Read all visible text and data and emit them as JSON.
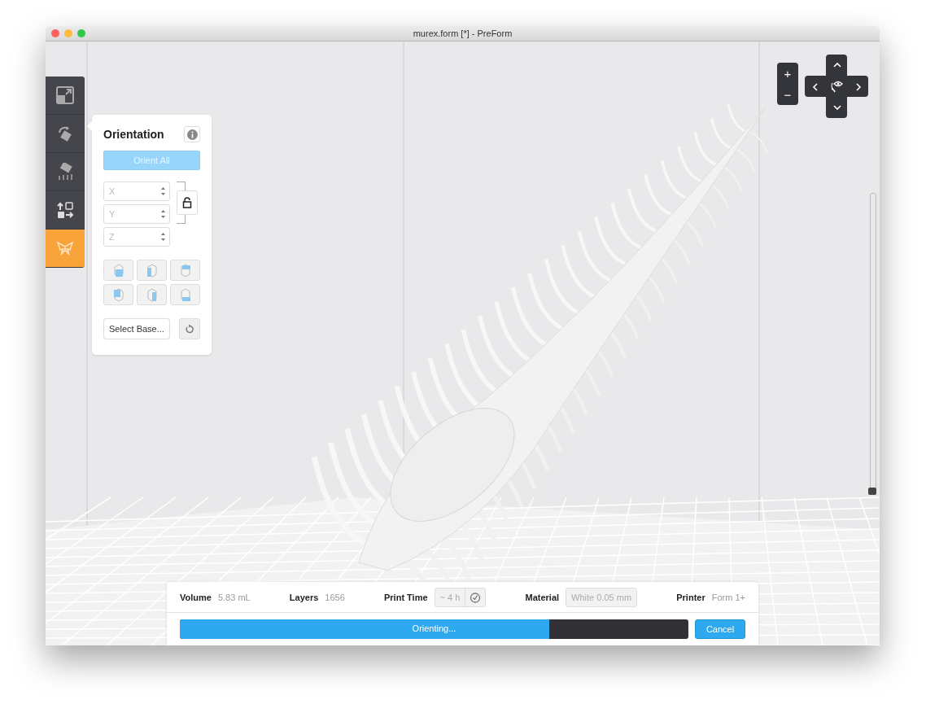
{
  "window": {
    "title": "murex.form [*] - PreForm"
  },
  "toolbar": [
    {
      "kind": "scale",
      "selected": false
    },
    {
      "kind": "orient",
      "selected": false
    },
    {
      "kind": "supports",
      "selected": false
    },
    {
      "kind": "layout",
      "selected": false
    },
    {
      "kind": "butterfly",
      "selected": true
    }
  ],
  "panel": {
    "title": "Orientation",
    "orient_all": "Orient All",
    "axes": [
      {
        "placeholder": "X"
      },
      {
        "placeholder": "Y"
      },
      {
        "placeholder": "Z"
      }
    ],
    "locked": false,
    "views": [
      {
        "kind": "front"
      },
      {
        "kind": "left"
      },
      {
        "kind": "top"
      },
      {
        "kind": "back"
      },
      {
        "kind": "right"
      },
      {
        "kind": "bottom"
      }
    ],
    "select_base": "Select Base..."
  },
  "zoom": [
    "+",
    "−"
  ],
  "layer_slider": {
    "level": 0
  },
  "stats": [
    {
      "label": "Volume",
      "value": "5.83 mL",
      "kind": "text"
    },
    {
      "label": "Layers",
      "value": "1656",
      "kind": "text"
    },
    {
      "label": "Print Time",
      "value": "~ 4 h",
      "kind": "time"
    },
    {
      "label": "Material",
      "value": "White 0.05 mm",
      "kind": "field"
    },
    {
      "label": "Printer",
      "value": "Form 1+",
      "kind": "text"
    }
  ],
  "progress": {
    "label": "Orienting...",
    "level": 0.727
  },
  "cancel": "Cancel"
}
